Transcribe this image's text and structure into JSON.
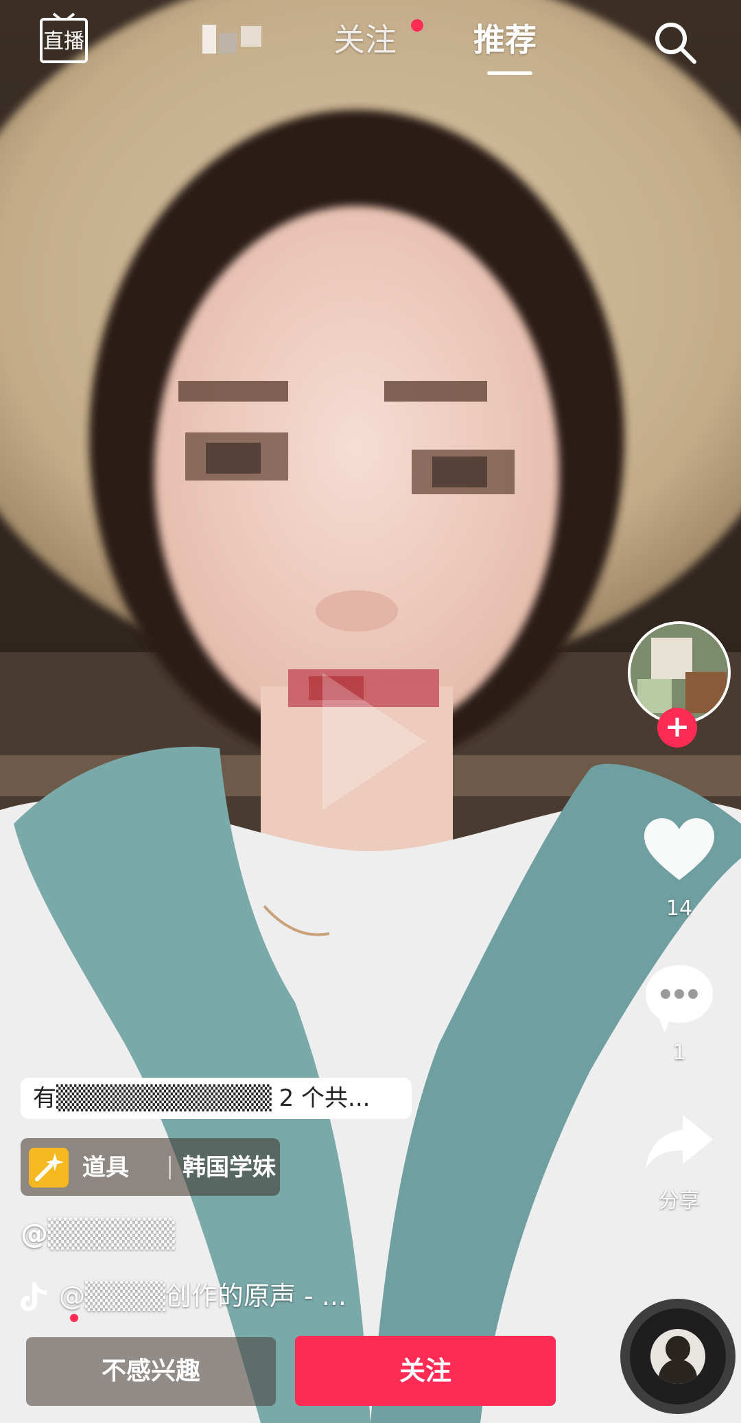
{
  "top_nav": {
    "live_label": "直播",
    "blurred_tab_label": "",
    "follow_tab_label": "关注",
    "recommend_tab_label": "推荐"
  },
  "right_rail": {
    "like_count": "14",
    "comment_count": "1",
    "share_label": "分享"
  },
  "video_info": {
    "banner_text": "有▒▒▒▒▒▒▒▒▒▒▒▒ 2 个共...",
    "prop_label": "道具",
    "prop_name": "韩国学妹",
    "username": "@▒▒▒▒▒▒",
    "music_text": "@▒▒▒▒创作的原声 - ..."
  },
  "actions": {
    "not_interested_label": "不感兴趣",
    "follow_label": "关注"
  },
  "colors": {
    "accent": "#fe2c55",
    "prop_icon": "#f5b91f"
  }
}
